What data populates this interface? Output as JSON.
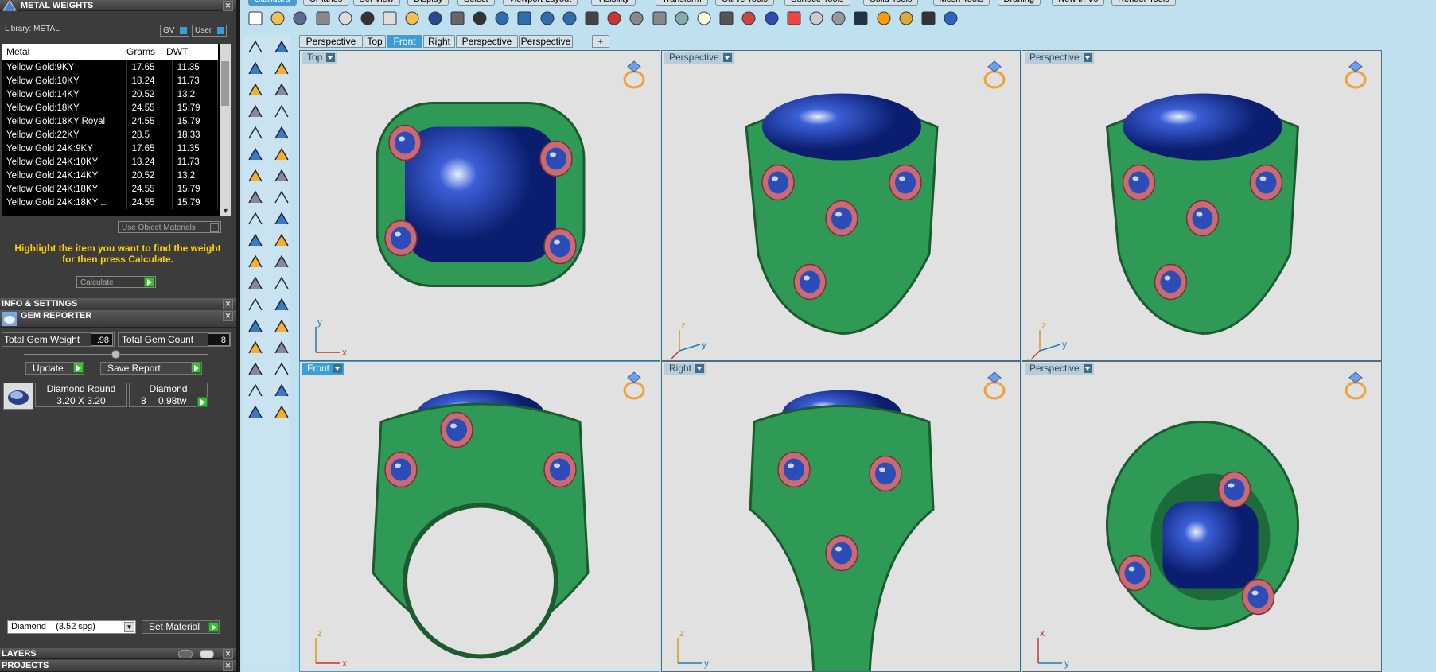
{
  "metal_panel": {
    "title": "METAL WEIGHTS",
    "library_label": "Library: METAL",
    "gv_label": "GV",
    "user_label": "User",
    "columns": [
      "Metal",
      "Grams",
      "DWT"
    ],
    "rows": [
      {
        "metal": "Yellow Gold:9KY",
        "grams": "17.65",
        "dwt": "11.35"
      },
      {
        "metal": "Yellow Gold:10KY",
        "grams": "18.24",
        "dwt": "11.73"
      },
      {
        "metal": "Yellow Gold:14KY",
        "grams": "20.52",
        "dwt": "13.2"
      },
      {
        "metal": "Yellow Gold:18KY",
        "grams": "24.55",
        "dwt": "15.79"
      },
      {
        "metal": "Yellow Gold:18KY Royal",
        "grams": "24.55",
        "dwt": "15.79"
      },
      {
        "metal": "Yellow Gold:22KY",
        "grams": "28.5",
        "dwt": "18.33"
      },
      {
        "metal": "Yellow Gold 24K:9KY",
        "grams": "17.65",
        "dwt": "11.35"
      },
      {
        "metal": "Yellow Gold 24K:10KY",
        "grams": "18.24",
        "dwt": "11.73"
      },
      {
        "metal": "Yellow Gold 24K:14KY",
        "grams": "20.52",
        "dwt": "13.2"
      },
      {
        "metal": "Yellow Gold 24K:18KY",
        "grams": "24.55",
        "dwt": "15.79"
      },
      {
        "metal": "Yellow Gold 24K:18KY ...",
        "grams": "24.55",
        "dwt": "15.79"
      }
    ],
    "use_object_materials": "Use Object Materials",
    "hint": "Highlight the item you want to find the weight for then press Calculate.",
    "calculate_label": "Calculate"
  },
  "info_settings_title": "INFO & SETTINGS",
  "gem_panel": {
    "title": "GEM REPORTER",
    "total_weight_label": "Total Gem Weight",
    "total_weight_value": ".98",
    "total_count_label": "Total Gem Count",
    "total_count_value": "8",
    "update_label": "Update",
    "save_report_label": "Save Report",
    "gem": {
      "name": "Diamond Round",
      "size": "3.20 X 3.20",
      "material": "Diamond",
      "count": "8",
      "weight": "0.98tw"
    },
    "material_select": "Diamond    (3.52 spg)",
    "set_material_label": "Set Material"
  },
  "layers_title": "LAYERS",
  "projects_title": "PROJECTS",
  "menu_tabs": [
    "Standard",
    "CPlanes",
    "Set View",
    "Display",
    "Select",
    "Viewport Layout",
    "Visibility",
    "Transform",
    "Curve Tools",
    "Surface Tools",
    "Solid Tools",
    "Mesh Tools",
    "Drafting",
    "New in V5",
    "Render Tools"
  ],
  "viewport_tabs": [
    "Perspective",
    "Top",
    "Front",
    "Right",
    "Perspective",
    "Perspective"
  ],
  "active_tab": "Front",
  "viewports": [
    {
      "label": "Top",
      "axes": [
        "y",
        "x"
      ]
    },
    {
      "label": "Perspective",
      "axes": [
        "z",
        "y",
        "x"
      ]
    },
    {
      "label": "Perspective",
      "axes": [
        "z",
        "y",
        "x"
      ]
    },
    {
      "label": "Front",
      "axes": [
        "z",
        "x"
      ]
    },
    {
      "label": "Right",
      "axes": [
        "z",
        "y"
      ]
    },
    {
      "label": "Perspective",
      "axes": [
        "x",
        "y"
      ]
    }
  ],
  "colors": {
    "ring_green": "#2f9a55",
    "gem_blue": "#1c3fa8",
    "accent": "#3a9fd8",
    "hint_yellow": "#ffd200"
  }
}
